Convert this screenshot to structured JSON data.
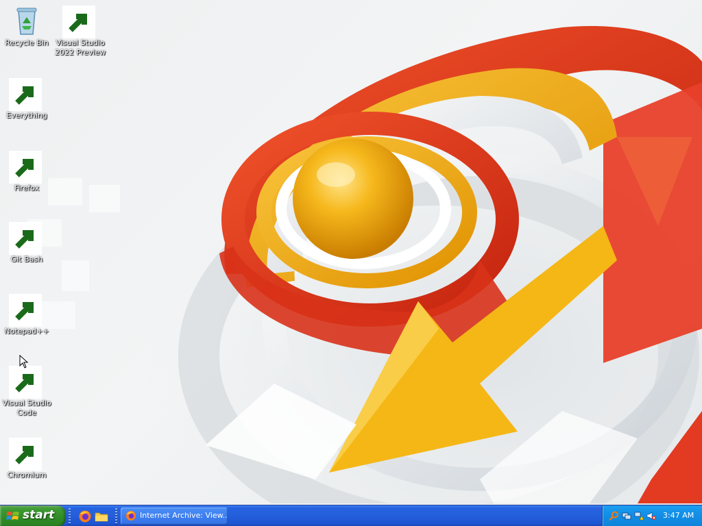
{
  "desktop": {
    "icons": [
      {
        "label": "Recycle Bin",
        "icon": "recycle-bin-icon"
      },
      {
        "label": "Visual Studio 2022 Preview",
        "icon": "document-icon"
      },
      {
        "label": "Everything",
        "icon": "magnifier-icon"
      },
      {
        "label": "Firefox",
        "icon": "firefox-icon"
      },
      {
        "label": "Git Bash",
        "icon": "git-icon"
      },
      {
        "label": "Notepad++",
        "icon": "notepad-plus-plus-icon"
      },
      {
        "label": "Visual Studio Code",
        "icon": "vscode-icon"
      },
      {
        "label": "Chromium",
        "icon": "chromium-icon"
      }
    ]
  },
  "taskbar": {
    "start_label": "start",
    "quick_launch": [
      {
        "icon": "firefox-icon"
      },
      {
        "icon": "folder-icon"
      }
    ],
    "tasks": [
      {
        "label": "Internet Archive: View...",
        "icon": "firefox-icon"
      }
    ],
    "tray": {
      "icons": [
        "magnifier-icon",
        "network-icon",
        "network-alert-icon",
        "volume-muted-icon"
      ],
      "clock": "3:47 AM"
    }
  },
  "colors": {
    "taskbar_blue": "#245edb",
    "start_green": "#3c9a32",
    "tray_blue": "#1290e8",
    "ribbon_red": "#e83a1f",
    "ribbon_yellow": "#f2b01a"
  }
}
